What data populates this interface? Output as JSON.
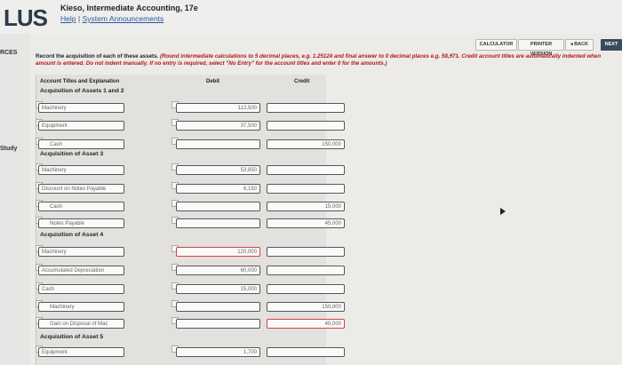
{
  "header": {
    "logo": "LUS",
    "book_title": "Kieso, Intermediate Accounting, 17e",
    "help": "Help",
    "separator": "|",
    "system_announcements": "System Announcements"
  },
  "sidebar": {
    "resources_label": "RCES",
    "study_label": "Study"
  },
  "nav": {
    "calculator": "CALCULATOR",
    "printer_version": "PRINTER VERSION",
    "back": "◂ BACK",
    "next": "NEXT"
  },
  "instructions": {
    "intro": "Record the acquisition of each of these assets. ",
    "rule": "(Round intermediate calculations to 5 decimal places, e.g. 1.25124 and final answer to 0 decimal places e.g. 58,971. Credit account titles are automatically indented when amount is entered. Do not indent manually. If no entry is required, select \"No Entry\" for the account titles and enter 0 for the amounts.)"
  },
  "table": {
    "col_account": "Account Titles and Explanation",
    "col_debit": "Debit",
    "col_credit": "Credit",
    "sections": [
      {
        "title": "Acquisition of Assets 1 and 2",
        "rows": [
          {
            "account": "Machinery",
            "debit": "112,500",
            "credit": ""
          },
          {
            "account": "Equipment",
            "debit": "37,500",
            "credit": ""
          },
          {
            "account": "Cash",
            "debit": "",
            "credit": "150,000"
          }
        ]
      },
      {
        "title": "Acquisition of Asset 3",
        "rows": [
          {
            "account": "Machinery",
            "debit": "53,850",
            "credit": ""
          },
          {
            "account": "Discount on Notes Payable",
            "debit": "6,150",
            "credit": ""
          },
          {
            "account": "Cash",
            "debit": "",
            "credit": "15,000"
          },
          {
            "account": "Notes Payable",
            "debit": "",
            "credit": "45,000"
          }
        ]
      },
      {
        "title": "Acquisition of Asset 4",
        "rows": [
          {
            "account": "Machinery",
            "debit": "120,000",
            "credit": ""
          },
          {
            "account": "Accumulated Depreciation",
            "debit": "60,000",
            "credit": ""
          },
          {
            "account": "Cash",
            "debit": "15,000",
            "credit": ""
          },
          {
            "account": "Machinery",
            "debit": "",
            "credit": "150,000"
          },
          {
            "account": "Gain on Disposal of Mac",
            "debit": "",
            "credit": "45,000"
          }
        ]
      },
      {
        "title": "Acquisition of Asset 5",
        "rows": [
          {
            "account": "Equipment",
            "debit": "1,700",
            "credit": ""
          }
        ]
      }
    ]
  },
  "colors": {
    "next_button": "#3a4a5e",
    "error_border": "#d04040",
    "instruction_red": "#b01818"
  }
}
